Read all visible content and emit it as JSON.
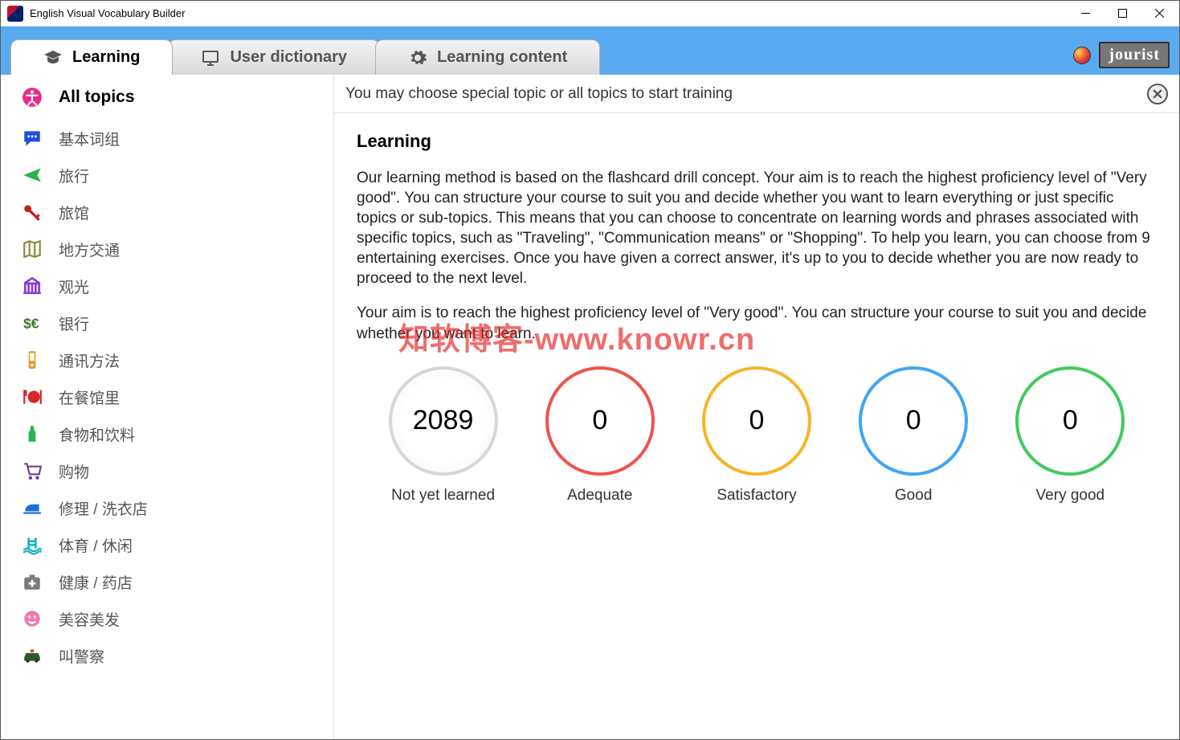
{
  "window": {
    "title": "English Visual Vocabulary Builder"
  },
  "tabs": [
    {
      "label": "Learning",
      "icon": "graduation-cap-icon"
    },
    {
      "label": "User dictionary",
      "icon": "monitor-icon"
    },
    {
      "label": "Learning content",
      "icon": "gear-icon"
    }
  ],
  "brand": {
    "logo_text": "jourist"
  },
  "sidebar": {
    "items": [
      {
        "label": "All topics",
        "icon": "accessibility-icon",
        "color": "#ec2a8b",
        "selected": true
      },
      {
        "label": "基本词组",
        "icon": "speech-bubble-icon",
        "color": "#1e4fd8"
      },
      {
        "label": "旅行",
        "icon": "airplane-icon",
        "color": "#2bb24c"
      },
      {
        "label": "旅馆",
        "icon": "keys-icon",
        "color": "#c21f1f"
      },
      {
        "label": "地方交通",
        "icon": "map-icon",
        "color": "#8a8a45"
      },
      {
        "label": "观光",
        "icon": "temple-icon",
        "color": "#8a3fd1"
      },
      {
        "label": "银行",
        "icon": "currency-icon",
        "color": "#3a7a2a"
      },
      {
        "label": "通讯方法",
        "icon": "phone-icon",
        "color": "#e0a020"
      },
      {
        "label": "在餐馆里",
        "icon": "cutlery-icon",
        "color": "#d62828"
      },
      {
        "label": "食物和饮料",
        "icon": "bottle-icon",
        "color": "#2bb24c"
      },
      {
        "label": "购物",
        "icon": "cart-icon",
        "color": "#6b3fa0"
      },
      {
        "label": "修理 / 洗衣店",
        "icon": "iron-icon",
        "color": "#1e6fd8"
      },
      {
        "label": "体育 / 休闲",
        "icon": "pool-icon",
        "color": "#17b2c4"
      },
      {
        "label": "健康 / 药店",
        "icon": "medkit-icon",
        "color": "#7a7a7a"
      },
      {
        "label": "美容美发",
        "icon": "face-icon",
        "color": "#ef7ab0"
      },
      {
        "label": "叫警察",
        "icon": "police-car-icon",
        "color": "#2e5a2e"
      }
    ]
  },
  "main": {
    "hint": "You may choose special topic or all topics to start training",
    "heading": "Learning",
    "para1": "Our learning method is based on the flashcard drill concept. Your aim is to reach the highest proficiency level of \"Very good\". You can structure your course to suit you and decide whether you want to learn everything or just specific topics or sub-topics. This means that you can choose to concentrate on learning words and phrases associated with specific topics, such as \"Traveling\", \"Communication means\" or \"Shopping\". To help you learn, you can choose from 9 entertaining exercises. Once you have given a correct answer, it's up to you to decide whether you are now ready to proceed to the next level.",
    "para2": "Your aim is to reach the highest proficiency level of \"Very good\". You can structure your course to suit you and decide whether you want to learn.",
    "watermark": "知软博客-www.knowr.cn",
    "stats": [
      {
        "value": "2089",
        "label": "Not yet learned"
      },
      {
        "value": "0",
        "label": "Adequate"
      },
      {
        "value": "0",
        "label": "Satisfactory"
      },
      {
        "value": "0",
        "label": "Good"
      },
      {
        "value": "0",
        "label": "Very good"
      }
    ]
  }
}
